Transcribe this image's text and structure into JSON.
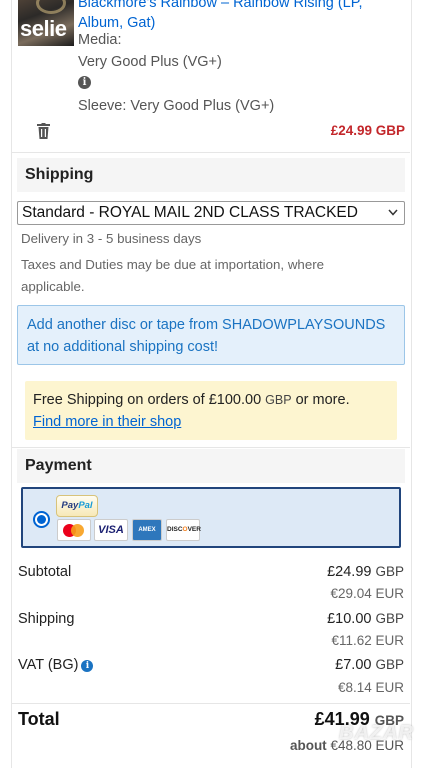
{
  "item": {
    "cover_text": "selie",
    "title_line1": "Blackmore's Rainbow – Rainbow Rising (LP,",
    "title_line2": "Album, Gat)",
    "media_label": "Media:",
    "media_value": "Very Good Plus (VG+)",
    "sleeve": "Sleeve: Very Good Plus (VG+)",
    "price": "£24.99 GBP"
  },
  "shipping": {
    "header": "Shipping",
    "selected_method": "Standard - ROYAL MAIL 2ND CLASS TRACKED",
    "delivery": "Delivery in 3 - 5 business days",
    "taxes_line1": "Taxes and Duties may be due at importation, where",
    "taxes_line2": "applicable.",
    "info_line1": "Add another disc or tape from SHADOWPLAYSOUNDS",
    "info_line2": "at no additional shipping cost!",
    "promo_prefix": "Free Shipping on orders of £100.00",
    "promo_currency": "GBP",
    "promo_suffix": "or more.",
    "promo_link": "Find more in their shop"
  },
  "payment": {
    "header": "Payment",
    "logos": {
      "paypal_pay": "Pay",
      "paypal_pal": "Pal",
      "visa": "VISA",
      "amex": "AMEX",
      "discover_a": "DISC",
      "discover_b": "O",
      "discover_c": "VER"
    }
  },
  "summary": {
    "subtotal_label": "Subtotal",
    "subtotal_value": "£24.99",
    "subtotal_currency": "GBP",
    "subtotal_eur": "€29.04 EUR",
    "shipping_label": "Shipping",
    "shipping_value": "£10.00",
    "shipping_currency": "GBP",
    "shipping_eur": "€11.62 EUR",
    "vat_label": "VAT (BG)",
    "vat_value": "£7.00",
    "vat_currency": "GBP",
    "vat_eur": "€8.14 EUR",
    "total_label": "Total",
    "total_value": "£41.99",
    "total_currency": "GBP",
    "total_about": "about",
    "total_eur": "€48.80 EUR"
  },
  "watermark": "BAZAR",
  "colors": {
    "link": "#0064d2",
    "price_red": "#c3272b",
    "info_bg": "#e4f0fb",
    "promo_bg": "#fdf5d0",
    "payment_border": "#21457c"
  },
  "icons": {
    "info": "info-icon",
    "trash": "trash-icon",
    "chevron": "chevron-down-icon",
    "radio": "radio-selected-icon"
  }
}
